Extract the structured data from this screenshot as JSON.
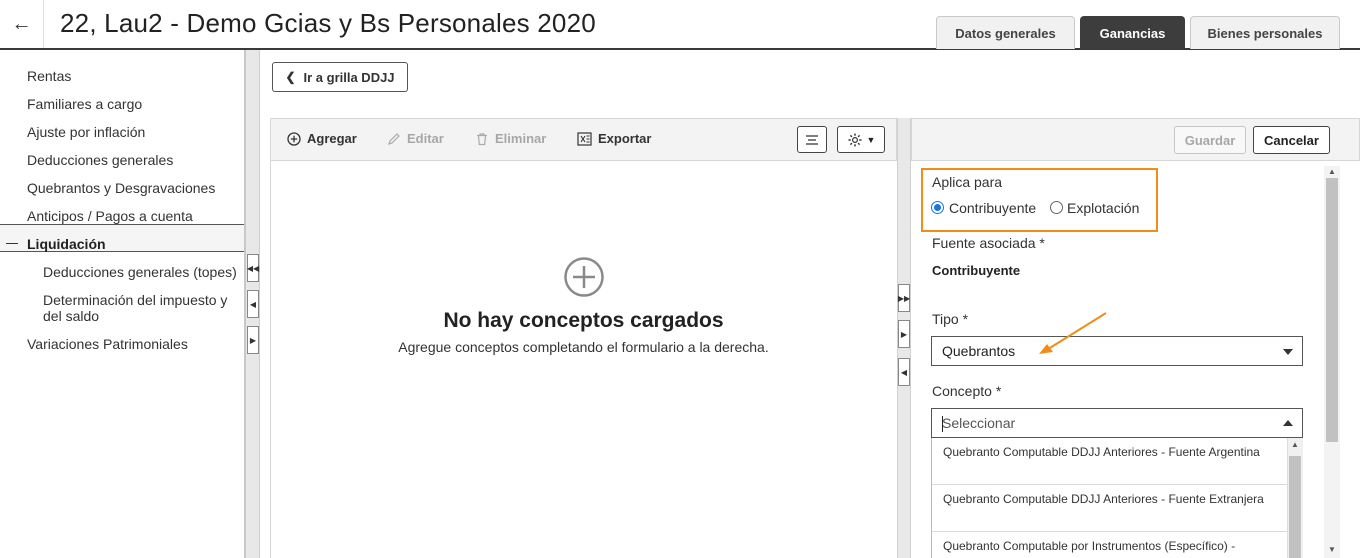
{
  "header": {
    "back_icon": "arrow-left-icon",
    "title": "22, Lau2 - Demo Gcias y Bs Personales 2020",
    "tabs": [
      {
        "label": "Datos generales",
        "active": false
      },
      {
        "label": "Ganancias",
        "active": true
      },
      {
        "label": "Bienes personales",
        "active": false
      }
    ]
  },
  "sidebar": {
    "items": [
      {
        "label": "Rentas"
      },
      {
        "label": "Familiares a cargo"
      },
      {
        "label": "Ajuste por inflación"
      },
      {
        "label": "Deducciones generales"
      },
      {
        "label": "Quebrantos y Desgravaciones",
        "active": true
      },
      {
        "label": "Anticipos / Pagos a cuenta"
      },
      {
        "label": "Liquidación",
        "expanded": true
      },
      {
        "label": "Deducciones generales (topes)"
      },
      {
        "label": "Determinación del impuesto y del saldo"
      },
      {
        "label": "Variaciones Patrimoniales"
      }
    ]
  },
  "grid_button": {
    "label": "Ir a grilla DDJJ",
    "icon": "chevron-left-icon"
  },
  "toolbar": {
    "add_label": "Agregar",
    "edit_label": "Editar",
    "delete_label": "Eliminar",
    "export_label": "Exportar"
  },
  "empty_state": {
    "icon": "plus-circle-icon",
    "title": "No hay conceptos cargados",
    "subtitle": "Agregue conceptos completando el formulario a la derecha."
  },
  "form_toolbar": {
    "save_label": "Guardar",
    "cancel_label": "Cancelar"
  },
  "form": {
    "aplica_para": {
      "label": "Aplica para",
      "options": [
        "Contribuyente",
        "Explotación"
      ],
      "selected": "Contribuyente"
    },
    "fuente": {
      "label": "Fuente asociada *",
      "value": "Contribuyente"
    },
    "tipo": {
      "label": "Tipo *",
      "value": "Quebrantos"
    },
    "concepto": {
      "label": "Concepto *",
      "placeholder": "Seleccionar",
      "options": [
        "Quebranto Computable DDJJ Anteriores - Fuente Argentina",
        "Quebranto Computable DDJJ Anteriores - Fuente Extranjera",
        "Quebranto Computable por Instrumentos (Específico) -"
      ]
    }
  },
  "colors": {
    "accent_highlight": "#f28c1a",
    "tab_active": "#3d3d3d",
    "radio_selected": "#1a73e8"
  }
}
